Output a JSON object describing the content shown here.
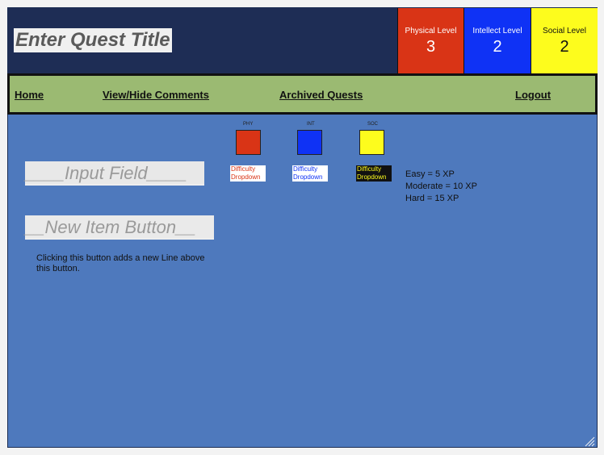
{
  "header": {
    "quest_title": "Enter Quest Title",
    "levels": [
      {
        "label": "Physical Level",
        "value": "3",
        "color": "#d93416"
      },
      {
        "label": "Intellect Level",
        "value": "2",
        "color": "#0f32f5"
      },
      {
        "label": "Social Level",
        "value": "2",
        "color": "#fdfc1d"
      }
    ]
  },
  "nav": {
    "items": [
      "Home",
      "View/Hide Comments",
      "Archived Quests",
      "Logout"
    ]
  },
  "stats": [
    {
      "abbr": "PHY",
      "dropdown": "Difficulty Dropdown",
      "color": "#d93416"
    },
    {
      "abbr": "INT",
      "dropdown": "Difficulty Dropdown",
      "color": "#0f32f5"
    },
    {
      "abbr": "SOC",
      "dropdown": "Difficulty Dropdown",
      "color": "#fdfc1d"
    }
  ],
  "input_field": "____Input Field____",
  "new_item_button": "__New Item Button__",
  "xp_legend": [
    "Easy = 5 XP",
    "Moderate = 10 XP",
    "Hard = 15 XP"
  ],
  "note": "Clicking this button adds a new Line above this button."
}
